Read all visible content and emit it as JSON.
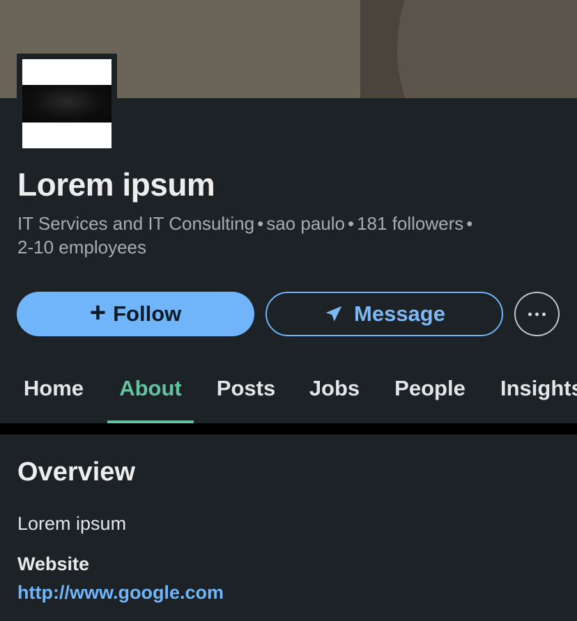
{
  "company": {
    "name": "Lorem ipsum",
    "industry": "IT Services and IT Consulting",
    "location": "sao paulo",
    "followers": "181 followers",
    "employees": "2-10 employees",
    "separator": "•"
  },
  "actions": {
    "follow_label": "Follow",
    "follow_icon": "plus-icon",
    "message_label": "Message",
    "message_icon": "send-icon",
    "more_icon": "more-icon"
  },
  "tabs": [
    {
      "label": "Home",
      "active": false
    },
    {
      "label": "About",
      "active": true
    },
    {
      "label": "Posts",
      "active": false
    },
    {
      "label": "Jobs",
      "active": false
    },
    {
      "label": "People",
      "active": false
    },
    {
      "label": "Insights",
      "active": false
    }
  ],
  "overview": {
    "title": "Overview",
    "description": "Lorem ipsum",
    "website_label": "Website",
    "website_url": "http://www.google.com"
  },
  "colors": {
    "background": "#1d2226",
    "accent_blue": "#70b5f9",
    "active_tab": "#64c39f"
  }
}
